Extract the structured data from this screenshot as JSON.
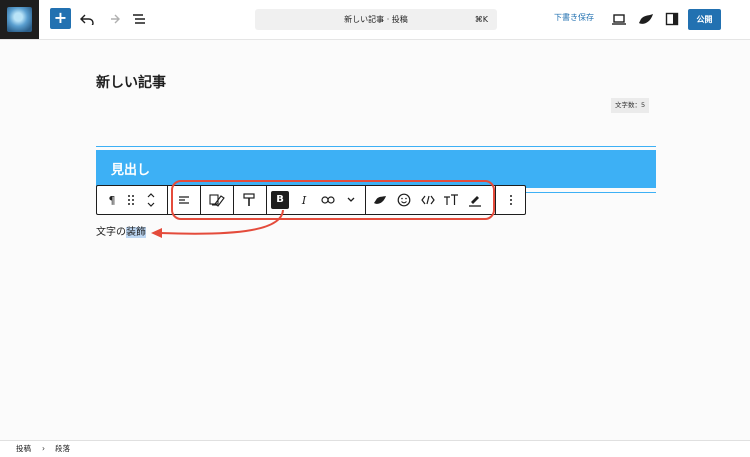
{
  "topbar": {
    "search_title": "新しい記事 · 投稿",
    "search_shortcut": "⌘K",
    "save_draft_label": "下書き保存",
    "publish_label": "公開",
    "add_label": "+"
  },
  "editor": {
    "post_title": "新しい記事",
    "word_count": "文字数：5",
    "heading_text": "見出し",
    "paragraph_prefix": "文字の",
    "paragraph_selected": "装飾"
  },
  "block_toolbar": {
    "paragraph_icon": "¶",
    "bold_label": "B",
    "italic_label": "I"
  },
  "breadcrumb": {
    "items": [
      "投稿",
      "段落"
    ],
    "separator": "›"
  },
  "colors": {
    "accent": "#2271b1",
    "heading_bg": "#3db0f5",
    "annotation": "#e44b3b",
    "selection": "#bcd6f2"
  }
}
